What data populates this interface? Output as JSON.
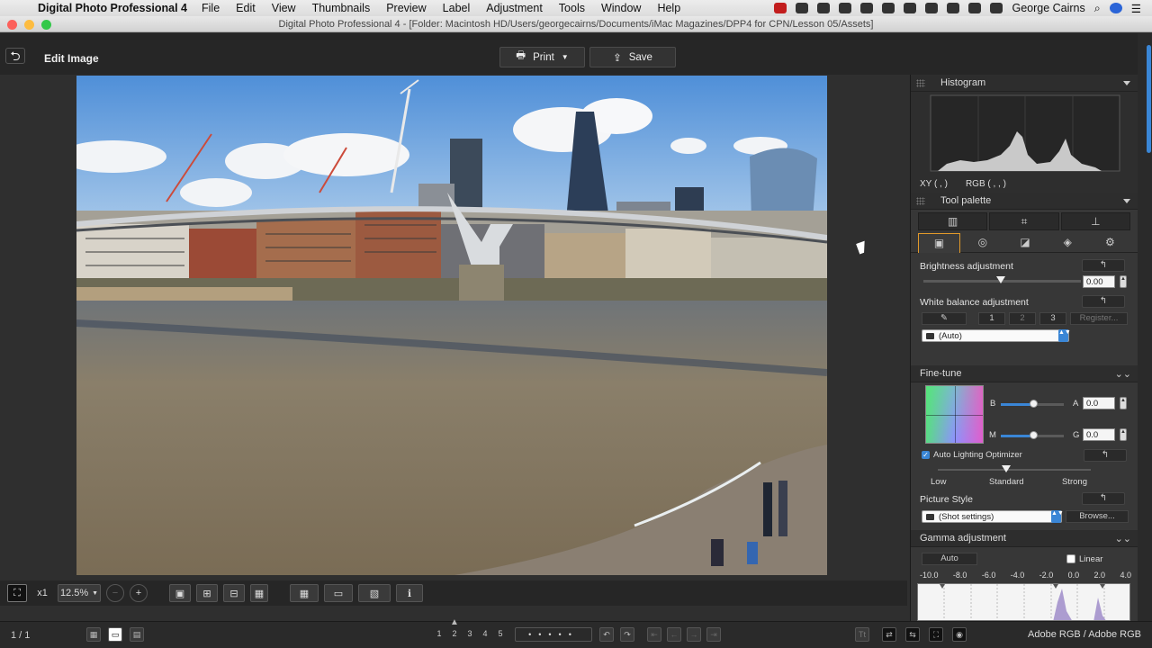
{
  "menubar": {
    "app_name": "Digital Photo Professional 4",
    "items": [
      "File",
      "Edit",
      "View",
      "Thumbnails",
      "Preview",
      "Label",
      "Adjustment",
      "Tools",
      "Window",
      "Help"
    ],
    "user": "George Cairns"
  },
  "window": {
    "title": "Digital Photo Professional 4 - [Folder: Macintosh HD/Users/georgecairns/Documents/iMac Magazines/DPP4 for CPN/Lesson 05/Assets]"
  },
  "toolbar": {
    "back_label": "⮌",
    "mode_label": "Edit Image",
    "print_label": "Print",
    "save_label": "Save"
  },
  "viewer_bar": {
    "fit_label": "⛶",
    "zoom_x1": "x1",
    "zoom_percent": "12.5%"
  },
  "status": {
    "count": "1 / 1",
    "color_space": "Adobe RGB / Adobe RGB"
  },
  "nav": {
    "rating_1": "1",
    "rating_2": "2",
    "rating_3": "3",
    "rating_4": "4",
    "rating_5": "5"
  },
  "panel": {
    "histogram_title": "Histogram",
    "xy_label": "XY (          ,          )",
    "rgb_label": "RGB (          ,          ,          )",
    "tool_palette_title": "Tool palette",
    "brightness_label": "Brightness adjustment",
    "brightness_value": "0.00",
    "wb_label": "White balance adjustment",
    "wb_buttons": [
      "1",
      "2",
      "3"
    ],
    "register_label": "Register...",
    "wb_select": "(Auto)",
    "finetune_title": "Fine-tune",
    "finetune_b": "B",
    "finetune_a": "A",
    "finetune_m": "M",
    "finetune_g": "G",
    "ba_value": "0.0",
    "mg_value": "0.0",
    "alo_label": "Auto Lighting Optimizer",
    "alo_low": "Low",
    "alo_standard": "Standard",
    "alo_strong": "Strong",
    "picture_style_label": "Picture Style",
    "picture_style_select": "(Shot settings)",
    "browse_label": "Browse...",
    "gamma_title": "Gamma adjustment",
    "gamma_auto": "Auto",
    "gamma_linear": "Linear",
    "gamma_ticks": [
      "-10.0",
      "-8.0",
      "-6.0",
      "-4.0",
      "-2.0",
      "0.0",
      "2.0",
      "4.0"
    ]
  },
  "colors": {
    "accent": "#3a86d6",
    "tab_active_border": "#e29a2a",
    "bg": "#2f2f2f"
  }
}
